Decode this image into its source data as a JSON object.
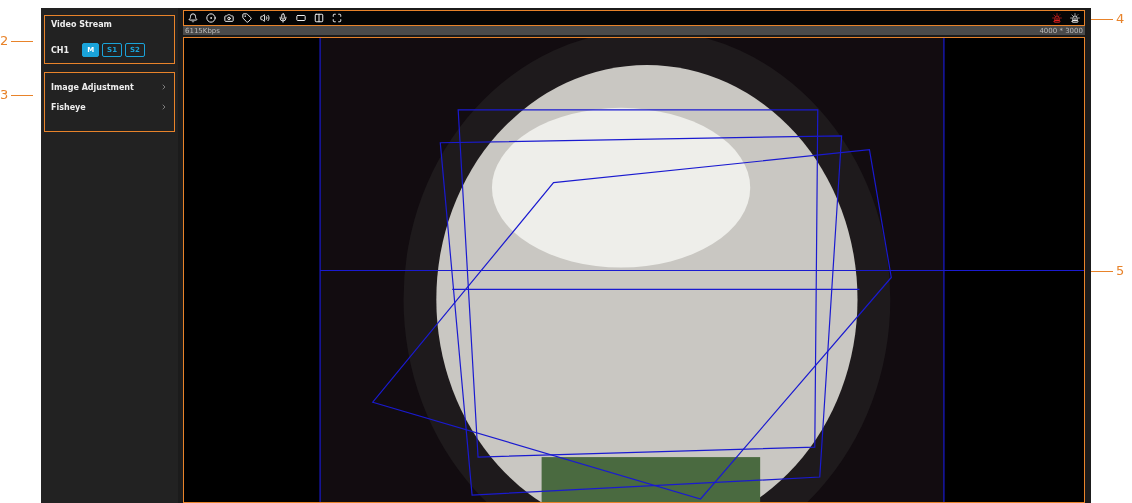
{
  "callouts": [
    {
      "label": "2"
    },
    {
      "label": "3"
    },
    {
      "label": "4"
    },
    {
      "label": "5"
    }
  ],
  "sidebar": {
    "video_stream": {
      "title": "Video Stream",
      "channel": "CH1",
      "streams": [
        {
          "label": "M",
          "selected": true
        },
        {
          "label": "S1",
          "selected": false
        },
        {
          "label": "S2",
          "selected": false
        }
      ]
    },
    "menu": [
      {
        "label": "Image Adjustment"
      },
      {
        "label": "Fisheye"
      }
    ]
  },
  "toolbar": {
    "alarm_active": true
  },
  "status_bar": {
    "bitrate": "6115Kbps",
    "resolution": "4000 * 3000"
  }
}
